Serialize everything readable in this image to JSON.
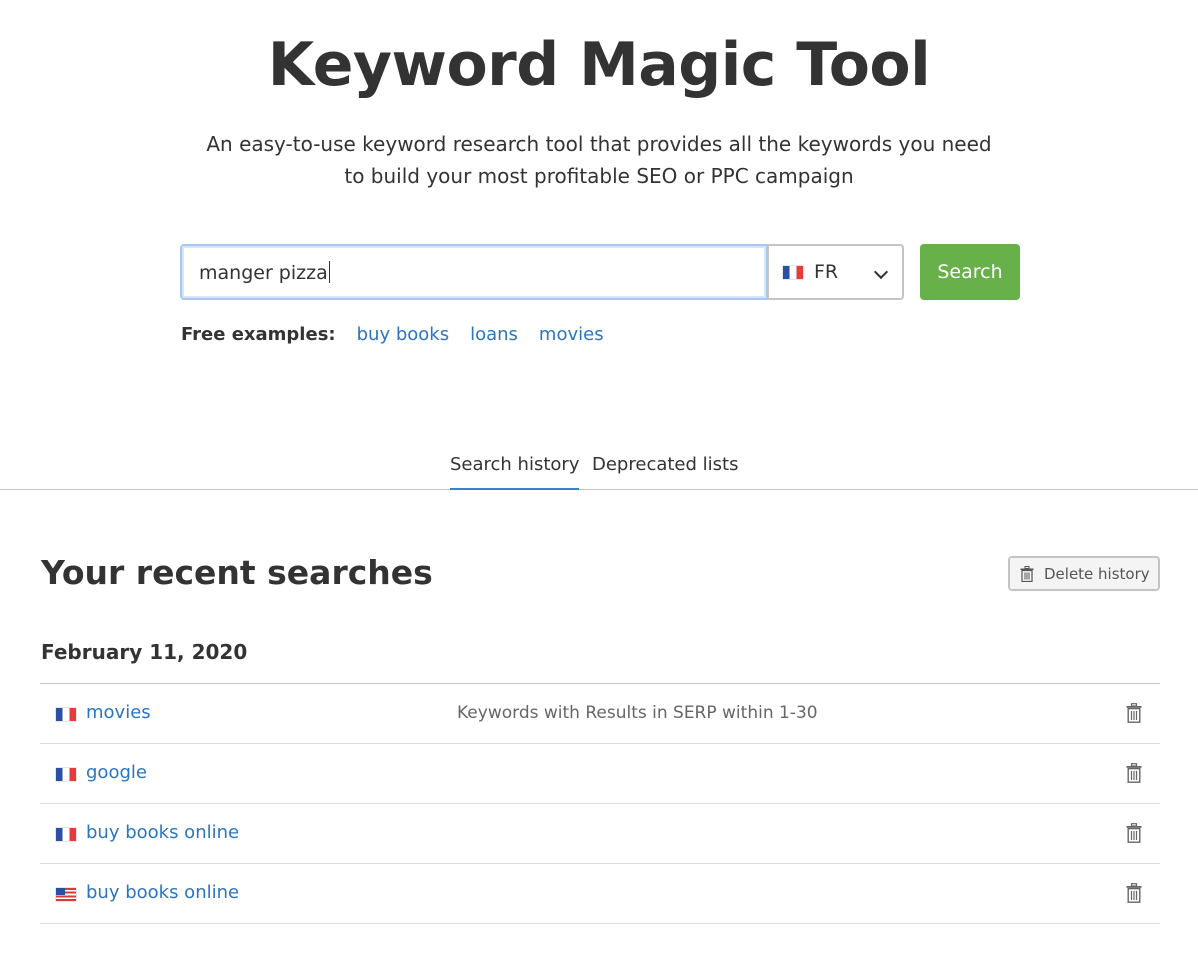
{
  "header": {
    "title": "Keyword Magic Tool",
    "subtitle_line1": "An easy-to-use keyword research tool that provides all the keywords you need",
    "subtitle_line2": "to build your most profitable SEO or PPC campaign"
  },
  "search": {
    "value": "manger pizza",
    "country": "FR",
    "country_flag": "flag-fr-icon",
    "button_label": "Search"
  },
  "examples": {
    "label": "Free examples:",
    "links": [
      "buy books",
      "loans",
      "movies"
    ]
  },
  "tabs": [
    {
      "label": "Search history",
      "active": true
    },
    {
      "label": "Deprecated lists",
      "active": false
    }
  ],
  "recent": {
    "title": "Your recent searches",
    "delete_label": "Delete history",
    "date": "February 11, 2020",
    "rows": [
      {
        "flag": "flag-fr-icon",
        "keyword": "movies",
        "filter": "Keywords with Results in SERP within 1-30"
      },
      {
        "flag": "flag-fr-icon",
        "keyword": "google",
        "filter": ""
      },
      {
        "flag": "flag-fr-icon",
        "keyword": "buy books online",
        "filter": ""
      },
      {
        "flag": "flag-us-icon",
        "keyword": "buy books online",
        "filter": ""
      }
    ]
  },
  "colors": {
    "accent_link": "#2c74c0",
    "search_button": "#67b04a",
    "active_tab_underline": "#3380cc"
  }
}
